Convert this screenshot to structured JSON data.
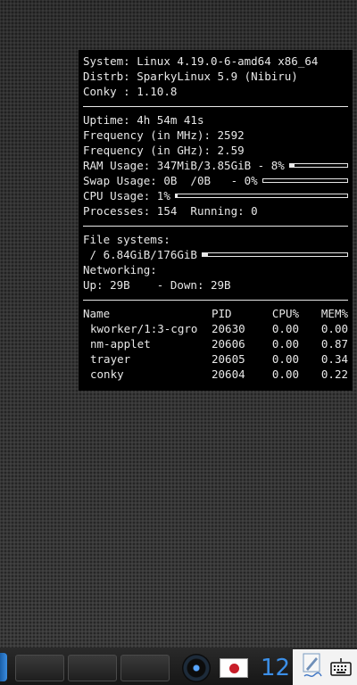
{
  "conky": {
    "system": {
      "label": "System: ",
      "value": "Linux 4.19.0-6-amd64 x86_64"
    },
    "distrb": {
      "label": "Distrb: ",
      "value": "SparkyLinux 5.9 (Nibiru)"
    },
    "conky_version": {
      "label": "Conky : ",
      "value": "1.10.8"
    },
    "uptime": {
      "label": "Uptime: ",
      "value": "4h 54m 41s"
    },
    "freq_mhz": {
      "label": "Frequency (in MHz): ",
      "value": "2592"
    },
    "freq_ghz": {
      "label": "Frequency (in GHz): ",
      "value": "2.59"
    },
    "ram": {
      "label": "RAM Usage: ",
      "value": "347MiB/3.85GiB - 8%",
      "fraction": 0.08
    },
    "swap": {
      "label": "Swap Usage: ",
      "value": "0B  /0B   - 0%",
      "fraction": 0.0
    },
    "cpu": {
      "label": "CPU Usage: ",
      "value": "1%",
      "fraction": 0.01
    },
    "processes": {
      "label": "Processes: ",
      "value": "154",
      "running_label": "  Running: ",
      "running_value": "0"
    },
    "filesystems": {
      "label": "File systems:",
      "root": " / 6.84GiB/176GiB",
      "fraction": 0.04
    },
    "networking": {
      "label": "Networking:",
      "up_label": "Up: ",
      "up_value": "29B",
      "down_label": "    - Down: ",
      "down_value": "29B"
    },
    "proc_table": {
      "headers": [
        "Name",
        "PID",
        "CPU%",
        "MEM%"
      ],
      "rows": [
        [
          "kworker/1:3-cgro",
          "20630",
          "0.00",
          "0.00"
        ],
        [
          "nm-applet",
          "20606",
          "0.00",
          "0.87"
        ],
        [
          "trayer",
          "20605",
          "0.00",
          "0.34"
        ],
        [
          "conky",
          "20604",
          "0.00",
          "0.22"
        ]
      ]
    }
  },
  "taskbar": {
    "clock_text": "12",
    "colors": {
      "accent": "#3b8fe8",
      "flag_red": "#c81e2a"
    }
  }
}
